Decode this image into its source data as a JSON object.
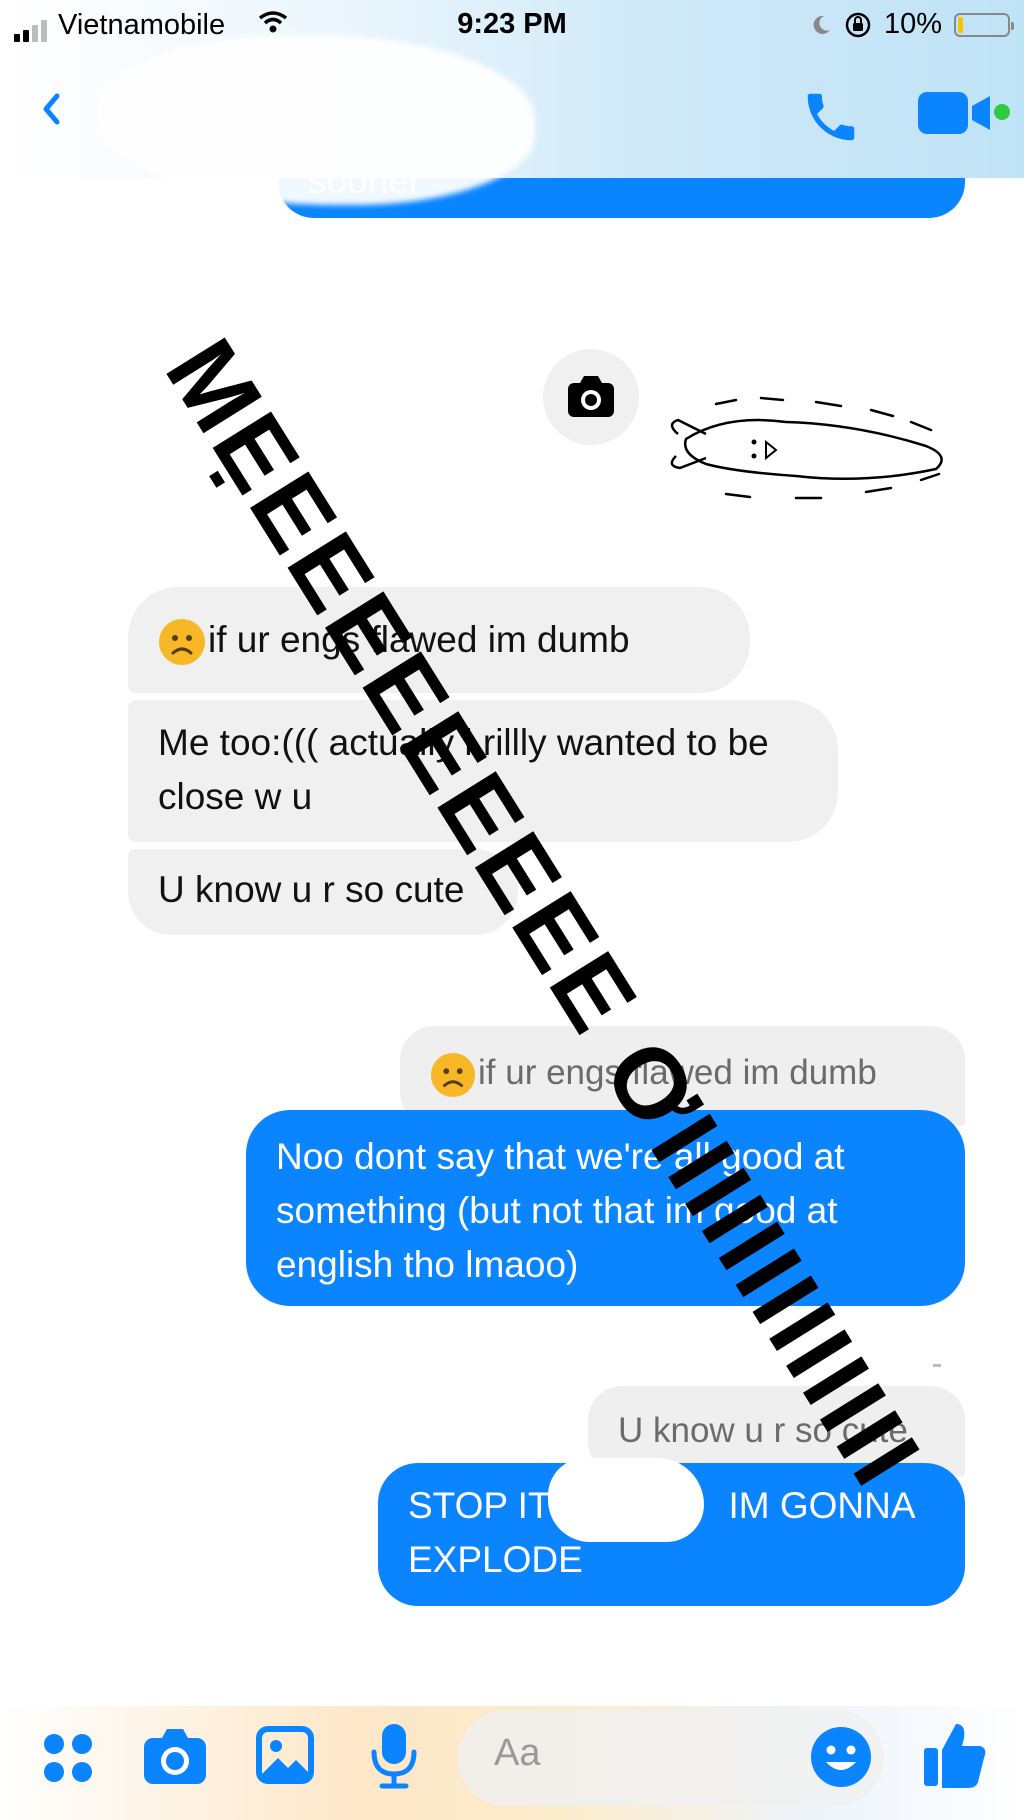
{
  "status_bar": {
    "carrier": "Vietnamobile",
    "time": "9:23 PM",
    "battery": "10%",
    "battery_level": 0.1
  },
  "header": {
    "back_icon": "chevron-left-icon",
    "call_icon": "phone-icon",
    "video_icon": "video-camera-icon",
    "active_color": "#2ecc40"
  },
  "messages": {
    "top_partial": "sooner",
    "in_1": "if ur engs flawed im dumb",
    "in_2": "Me too:((( actually i rillly wanted to be close w u",
    "in_3": "U know u r so cute",
    "reply_quote_1": "if ur engs flawed im dumb",
    "out_1": "Noo dont say that we're all good at something (but not that im good at english tho lmaoo)",
    "reply_quote_2": "U know u r so cute",
    "out_2_start": "STOP IT",
    "out_2_end": "IM GONNA EXPLODE"
  },
  "overlay": {
    "text": "MẸEEEEEEEEE ƠIIIIIIIIIIIII"
  },
  "composer": {
    "placeholder": "Aa",
    "icons": [
      "apps-icon",
      "camera-icon",
      "image-icon",
      "microphone-icon",
      "emoji-icon",
      "thumbs-up-icon"
    ]
  },
  "colors": {
    "accent": "#0a84ff",
    "incoming_bubble": "#f0f0f0"
  }
}
